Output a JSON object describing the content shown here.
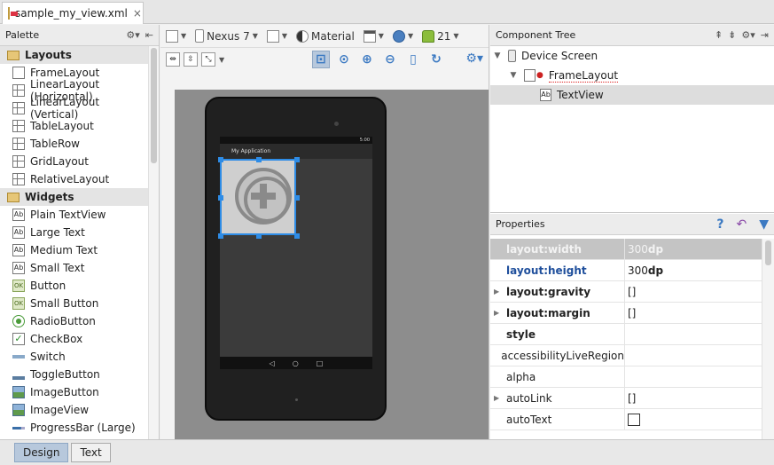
{
  "file_tab": {
    "label": "sample_my_view.xml",
    "close": "×"
  },
  "palette": {
    "title": "Palette",
    "categories": [
      {
        "label": "Layouts",
        "items": [
          "FrameLayout",
          "LinearLayout (Horizontal)",
          "LinearLayout (Vertical)",
          "TableLayout",
          "TableRow",
          "GridLayout",
          "RelativeLayout"
        ]
      },
      {
        "label": "Widgets",
        "items": [
          "Plain TextView",
          "Large Text",
          "Medium Text",
          "Small Text",
          "Button",
          "Small Button",
          "RadioButton",
          "CheckBox",
          "Switch",
          "ToggleButton",
          "ImageButton",
          "ImageView",
          "ProgressBar (Large)"
        ]
      }
    ]
  },
  "toolbar": {
    "device": "Nexus 7",
    "theme": "Material",
    "api": "21"
  },
  "device_preview": {
    "app_title": "My Application",
    "time": "5:00"
  },
  "component_tree": {
    "title": "Component Tree",
    "nodes": [
      "Device Screen",
      "FrameLayout",
      "TextView"
    ]
  },
  "properties": {
    "title": "Properties",
    "rows": [
      {
        "name": "layout:width",
        "value": "300",
        "unit": "dp"
      },
      {
        "name": "layout:height",
        "value": "300",
        "unit": "dp"
      },
      {
        "name": "layout:gravity",
        "value": "[]"
      },
      {
        "name": "layout:margin",
        "value": "[]"
      },
      {
        "name": "style",
        "value": ""
      },
      {
        "name": "accessibilityLiveRegion",
        "value": ""
      },
      {
        "name": "alpha",
        "value": ""
      },
      {
        "name": "autoLink",
        "value": "[]"
      },
      {
        "name": "autoText",
        "value": ""
      }
    ]
  },
  "bottom_tabs": {
    "design": "Design",
    "text": "Text"
  }
}
